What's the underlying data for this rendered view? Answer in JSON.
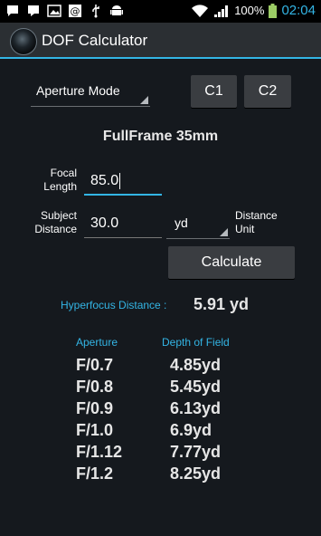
{
  "status_bar": {
    "left_icons": [
      "chat-icon",
      "message-icon",
      "image-icon",
      "at-icon",
      "usb-icon",
      "android-icon"
    ],
    "battery": "100%",
    "time": "02:04"
  },
  "action_bar": {
    "title": "DOF Calculator"
  },
  "mode_spinner": {
    "selected": "Aperture Mode"
  },
  "custom_buttons": {
    "c1": "C1",
    "c2": "C2"
  },
  "camera_format": "FullFrame 35mm",
  "focal_length": {
    "label_line1": "Focal",
    "label_line2": "Length",
    "value": "85.0"
  },
  "subject_distance": {
    "label_line1": "Subject",
    "label_line2": "Distance",
    "value": "30.0"
  },
  "distance_unit": {
    "selected": "yd",
    "label_line1": "Distance",
    "label_line2": "Unit"
  },
  "calculate_label": "Calculate",
  "hyperfocus": {
    "label": "Hyperfocus Distance :",
    "value": "5.91 yd"
  },
  "results": {
    "headers": {
      "aperture": "Aperture",
      "dof": "Depth of Field"
    },
    "rows": [
      {
        "aperture": "F/0.7",
        "dof": "4.85yd"
      },
      {
        "aperture": "F/0.8",
        "dof": "5.45yd"
      },
      {
        "aperture": "F/0.9",
        "dof": "6.13yd"
      },
      {
        "aperture": "F/1.0",
        "dof": "6.9yd"
      },
      {
        "aperture": "F/1.12",
        "dof": "7.77yd"
      },
      {
        "aperture": "F/1.2",
        "dof": "8.25yd"
      }
    ]
  },
  "colors": {
    "accent": "#33b5e5",
    "background": "#15191e",
    "button": "#3a3d41"
  }
}
